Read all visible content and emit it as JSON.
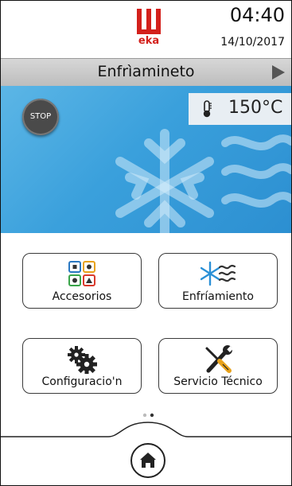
{
  "header": {
    "brand": "eka",
    "time": "04:40",
    "date": "14/10/2017"
  },
  "mode_bar": {
    "title": "Enfrìamineto",
    "arrow_icon": "play-triangle-icon"
  },
  "status_panel": {
    "stop_label": "STOP",
    "temperature": "150°C",
    "thermometer_icon": "thermometer-icon",
    "background_icon": "snowflake-wind-icon"
  },
  "menu": {
    "buttons": [
      {
        "label": "Accesorios",
        "icon": "accessories-grid-icon"
      },
      {
        "label": "Enfríamiento",
        "icon": "snowflake-wind-icon"
      },
      {
        "label": "Configuracio'n",
        "icon": "gears-icon"
      },
      {
        "label": "Servicio Técnico",
        "icon": "wrench-screwdriver-icon"
      }
    ]
  },
  "pager": {
    "pages": 2,
    "current": 2
  },
  "footer": {
    "home_icon": "home-icon"
  },
  "colors": {
    "brand_red": "#d3201b",
    "panel_blue": "#3aa0dc",
    "mode_bar_gray": "#c8c8c8"
  }
}
